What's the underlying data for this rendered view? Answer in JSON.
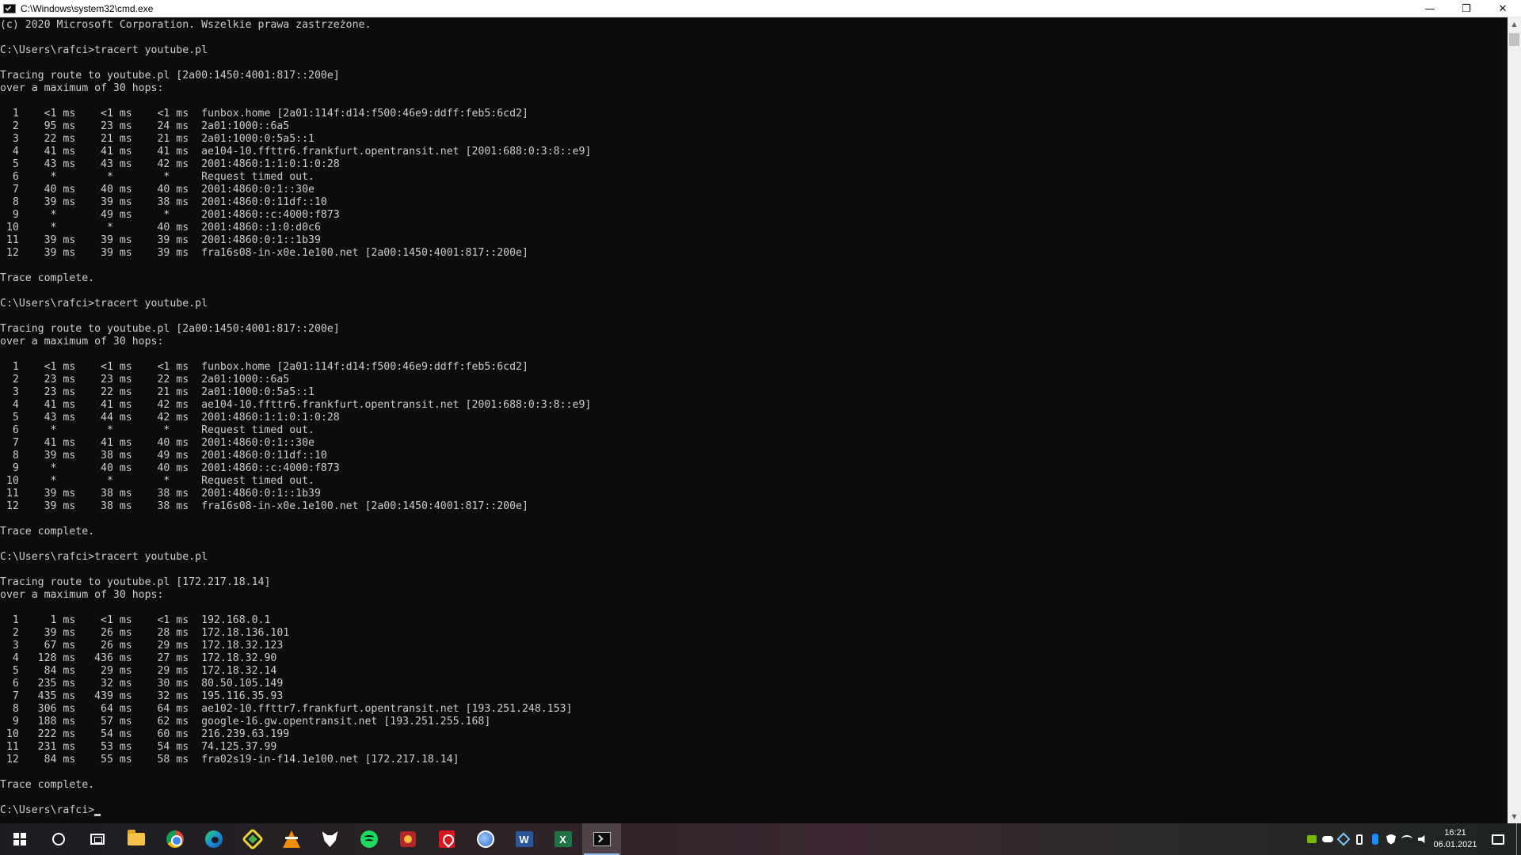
{
  "window": {
    "title": "C:\\Windows\\system32\\cmd.exe",
    "minimize_glyph": "—",
    "restore_glyph": "❐",
    "close_glyph": "✕"
  },
  "console": {
    "lines": [
      "(c) 2020 Microsoft Corporation. Wszelkie prawa zastrzeżone.",
      "",
      "C:\\Users\\rafci>tracert youtube.pl",
      "",
      "Tracing route to youtube.pl [2a00:1450:4001:817::200e]",
      "over a maximum of 30 hops:",
      "",
      "  1    <1 ms    <1 ms    <1 ms  funbox.home [2a01:114f:d14:f500:46e9:ddff:feb5:6cd2]",
      "  2    95 ms    23 ms    24 ms  2a01:1000::6a5",
      "  3    22 ms    21 ms    21 ms  2a01:1000:0:5a5::1",
      "  4    41 ms    41 ms    41 ms  ae104-10.ffttr6.frankfurt.opentransit.net [2001:688:0:3:8::e9]",
      "  5    43 ms    43 ms    42 ms  2001:4860:1:1:0:1:0:28",
      "  6     *        *        *     Request timed out.",
      "  7    40 ms    40 ms    40 ms  2001:4860:0:1::30e",
      "  8    39 ms    39 ms    38 ms  2001:4860:0:11df::10",
      "  9     *       49 ms     *     2001:4860::c:4000:f873",
      " 10     *        *       40 ms  2001:4860::1:0:d0c6",
      " 11    39 ms    39 ms    39 ms  2001:4860:0:1::1b39",
      " 12    39 ms    39 ms    39 ms  fra16s08-in-x0e.1e100.net [2a00:1450:4001:817::200e]",
      "",
      "Trace complete.",
      "",
      "C:\\Users\\rafci>tracert youtube.pl",
      "",
      "Tracing route to youtube.pl [2a00:1450:4001:817::200e]",
      "over a maximum of 30 hops:",
      "",
      "  1    <1 ms    <1 ms    <1 ms  funbox.home [2a01:114f:d14:f500:46e9:ddff:feb5:6cd2]",
      "  2    23 ms    23 ms    22 ms  2a01:1000::6a5",
      "  3    23 ms    22 ms    21 ms  2a01:1000:0:5a5::1",
      "  4    41 ms    41 ms    42 ms  ae104-10.ffttr6.frankfurt.opentransit.net [2001:688:0:3:8::e9]",
      "  5    43 ms    44 ms    42 ms  2001:4860:1:1:0:1:0:28",
      "  6     *        *        *     Request timed out.",
      "  7    41 ms    41 ms    40 ms  2001:4860:0:1::30e",
      "  8    39 ms    38 ms    49 ms  2001:4860:0:11df::10",
      "  9     *       40 ms    40 ms  2001:4860::c:4000:f873",
      " 10     *        *        *     Request timed out.",
      " 11    39 ms    38 ms    38 ms  2001:4860:0:1::1b39",
      " 12    39 ms    38 ms    38 ms  fra16s08-in-x0e.1e100.net [2a00:1450:4001:817::200e]",
      "",
      "Trace complete.",
      "",
      "C:\\Users\\rafci>tracert youtube.pl",
      "",
      "Tracing route to youtube.pl [172.217.18.14]",
      "over a maximum of 30 hops:",
      "",
      "  1     1 ms    <1 ms    <1 ms  192.168.0.1",
      "  2    39 ms    26 ms    28 ms  172.18.136.101",
      "  3    67 ms    26 ms    29 ms  172.18.32.123",
      "  4   128 ms   436 ms    27 ms  172.18.32.90",
      "  5    84 ms    29 ms    29 ms  172.18.32.14",
      "  6   235 ms    32 ms    30 ms  80.50.105.149",
      "  7   435 ms   439 ms    32 ms  195.116.35.93",
      "  8   306 ms    64 ms    64 ms  ae102-10.ffttr7.frankfurt.opentransit.net [193.251.248.153]",
      "  9   188 ms    57 ms    62 ms  google-16.gw.opentransit.net [193.251.255.168]",
      " 10   222 ms    54 ms    60 ms  216.239.63.199",
      " 11   231 ms    53 ms    54 ms  74.125.37.99",
      " 12    84 ms    55 ms    58 ms  fra02s19-in-f14.1e100.net [172.217.18.14]",
      "",
      "Trace complete.",
      ""
    ],
    "prompt": "C:\\Users\\rafci>"
  },
  "scrollbar": {
    "up_glyph": "▲",
    "down_glyph": "▼"
  },
  "taskbar": {
    "word_letter": "W",
    "excel_letter": "X",
    "clock_time": "16:21",
    "clock_date": "06.01.2021"
  }
}
